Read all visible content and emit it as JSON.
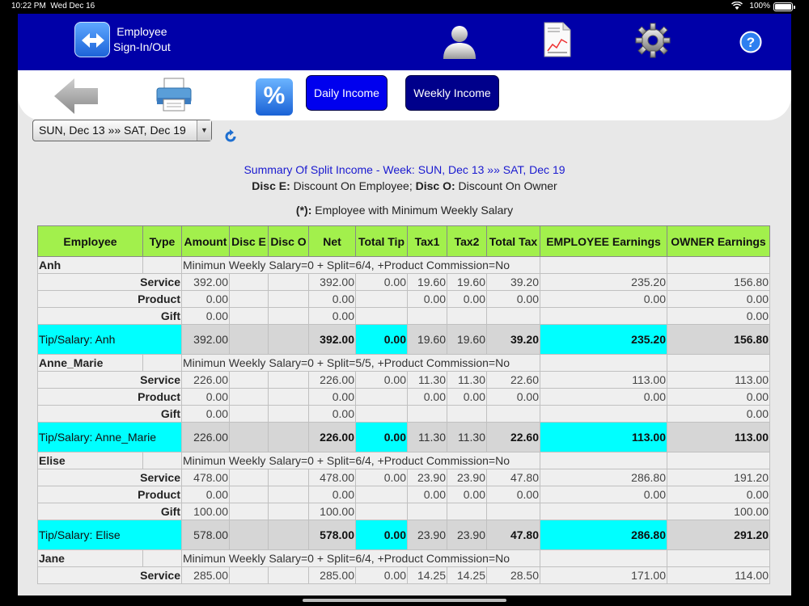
{
  "status_bar": {
    "time": "10:22 PM",
    "date": "Wed Dec 16",
    "battery": "100%"
  },
  "header": {
    "signin_line1": "Employee",
    "signin_line2": "Sign-In/Out"
  },
  "toolbar": {
    "percent_label": "%",
    "daily_income": "Daily Income",
    "weekly_income": "Weekly Income"
  },
  "date_range": {
    "selected": "SUN, Dec 13 »» SAT, Dec 19"
  },
  "summary": {
    "title": "Summary Of Split Income - Week: SUN, Dec 13 »» SAT, Dec 19",
    "disc_e_label": "Disc E:",
    "disc_e_text": " Discount On Employee; ",
    "disc_o_label": "Disc O:",
    "disc_o_text": " Discount On Owner",
    "min_label": "(*):",
    "min_text": " Employee with Minimum Weekly Salary"
  },
  "table": {
    "headers": [
      "Employee",
      "Type",
      "Amount",
      "Disc E",
      "Disc O",
      "Net",
      "Total Tip",
      "Tax1",
      "Tax2",
      "Total Tax",
      "EMPLOYEE Earnings",
      "OWNER Earnings"
    ],
    "employees": [
      {
        "name": "Anh",
        "info": "Minimun Weekly Salary=0 + Split=6/4, +Product Commission=No",
        "rows": [
          [
            "Service",
            "392.00",
            "",
            "",
            "392.00",
            "0.00",
            "19.60",
            "19.60",
            "39.20",
            "235.20",
            "156.80"
          ],
          [
            "Product",
            "0.00",
            "",
            "",
            "0.00",
            "",
            "0.00",
            "0.00",
            "0.00",
            "0.00",
            "0.00"
          ],
          [
            "Gift",
            "0.00",
            "",
            "",
            "0.00",
            "",
            "",
            "",
            "",
            "",
            "0.00"
          ]
        ],
        "tip": [
          "Tip/Salary: Anh",
          "392.00",
          "",
          "",
          "392.00",
          "0.00",
          "19.60",
          "19.60",
          "39.20",
          "235.20",
          "156.80"
        ]
      },
      {
        "name": "Anne_Marie",
        "info": "Minimun Weekly Salary=0 + Split=5/5, +Product Commission=No",
        "rows": [
          [
            "Service",
            "226.00",
            "",
            "",
            "226.00",
            "0.00",
            "11.30",
            "11.30",
            "22.60",
            "113.00",
            "113.00"
          ],
          [
            "Product",
            "0.00",
            "",
            "",
            "0.00",
            "",
            "0.00",
            "0.00",
            "0.00",
            "0.00",
            "0.00"
          ],
          [
            "Gift",
            "0.00",
            "",
            "",
            "0.00",
            "",
            "",
            "",
            "",
            "",
            "0.00"
          ]
        ],
        "tip": [
          "Tip/Salary: Anne_Marie",
          "226.00",
          "",
          "",
          "226.00",
          "0.00",
          "11.30",
          "11.30",
          "22.60",
          "113.00",
          "113.00"
        ]
      },
      {
        "name": "Elise",
        "info": "Minimun Weekly Salary=0 + Split=6/4, +Product Commission=No",
        "rows": [
          [
            "Service",
            "478.00",
            "",
            "",
            "478.00",
            "0.00",
            "23.90",
            "23.90",
            "47.80",
            "286.80",
            "191.20"
          ],
          [
            "Product",
            "0.00",
            "",
            "",
            "0.00",
            "",
            "0.00",
            "0.00",
            "0.00",
            "0.00",
            "0.00"
          ],
          [
            "Gift",
            "100.00",
            "",
            "",
            "100.00",
            "",
            "",
            "",
            "",
            "",
            "100.00"
          ]
        ],
        "tip": [
          "Tip/Salary: Elise",
          "578.00",
          "",
          "",
          "578.00",
          "0.00",
          "23.90",
          "23.90",
          "47.80",
          "286.80",
          "291.20"
        ]
      },
      {
        "name": "Jane",
        "info": "Minimun Weekly Salary=0 + Split=6/4, +Product Commission=No",
        "rows": [
          [
            "Service",
            "285.00",
            "",
            "",
            "285.00",
            "0.00",
            "14.25",
            "14.25",
            "28.50",
            "171.00",
            "114.00"
          ]
        ],
        "tip": null
      }
    ]
  },
  "colors": {
    "header_blue": "#0000a8",
    "table_header_green": "#a2f04c",
    "tip_cyan": "#00ffff",
    "daily_btn": "#0000ee",
    "weekly_btn": "#00008b"
  },
  "icons": [
    "sign-in-out-icon",
    "user-icon",
    "report-icon",
    "gear-icon",
    "help-icon",
    "back-arrow-icon",
    "printer-icon",
    "refresh-icon"
  ]
}
